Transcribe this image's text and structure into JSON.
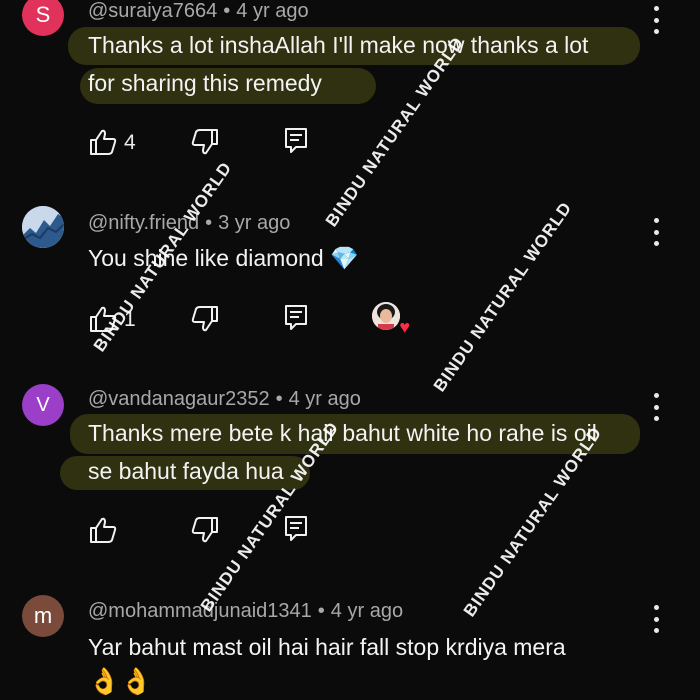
{
  "watermark": "BINDU NATURAL WORLD",
  "comments": [
    {
      "initial": "S",
      "avatar_color": "#e0325a",
      "username": "@suraiya7664",
      "age": "4 yr ago",
      "lines": [
        "Thanks a lot inshaAllah I'll make now thanks a lot",
        "for sharing this remedy"
      ],
      "likes": "4"
    },
    {
      "initial": "",
      "avatar_color": "#3a5f8f",
      "username": "@nifty.friend",
      "age": "3 yr ago",
      "lines": [
        "You shine like diamond 💎"
      ],
      "likes": "1"
    },
    {
      "initial": "V",
      "avatar_color": "#9b3fc8",
      "username": "@vandanagaur2352",
      "age": "4 yr ago",
      "lines": [
        "Thanks mere bete k hair bahut white ho rahe is oil",
        "se bahut fayda hua"
      ],
      "likes": ""
    },
    {
      "initial": "m",
      "avatar_color": "#7a4a3a",
      "username": "@mohammadjunaid1341",
      "age": "4 yr ago",
      "lines": [
        "Yar  bahut mast  oil hai hair fall  stop krdiya  mera"
      ],
      "likes": "",
      "emojis": "👌👌"
    }
  ],
  "colors": {
    "background": "#0b0b0b",
    "highlight": "#d2dc28",
    "heart": "#ff2b47"
  },
  "icons": [
    "like-icon",
    "dislike-icon",
    "reply-icon",
    "more-options-icon",
    "heart-icon"
  ]
}
